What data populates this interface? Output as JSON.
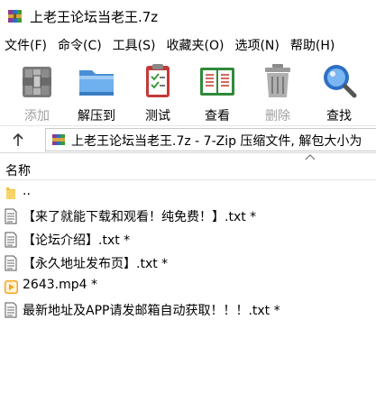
{
  "window": {
    "title": "上老王论坛当老王.7z"
  },
  "menu": [
    "文件(F)",
    "命令(C)",
    "工具(S)",
    "收藏夹(O)",
    "选项(N)",
    "帮助(H)"
  ],
  "toolbar": {
    "add": {
      "label": "添加",
      "enabled": false,
      "icon": "archive-add-icon"
    },
    "extract": {
      "label": "解压到",
      "enabled": true,
      "icon": "folder-extract-icon"
    },
    "test": {
      "label": "测试",
      "enabled": true,
      "icon": "clipboard-check-icon"
    },
    "view": {
      "label": "查看",
      "enabled": true,
      "icon": "open-book-icon"
    },
    "delete": {
      "label": "删除",
      "enabled": false,
      "icon": "trash-can-icon"
    },
    "find": {
      "label": "查找",
      "enabled": true,
      "icon": "magnifier-icon"
    }
  },
  "address": {
    "path": "上老王论坛当老王.7z - 7-Zip 压缩文件, 解包大小为"
  },
  "list": {
    "column_name": "名称",
    "items": [
      {
        "name": "..",
        "type": "folder"
      },
      {
        "name": "【来了就能下载和观看！纯免费！】.txt *",
        "type": "text"
      },
      {
        "name": "【论坛介绍】.txt *",
        "type": "text"
      },
      {
        "name": "【永久地址发布页】.txt *",
        "type": "text"
      },
      {
        "name": "2643.mp4 *",
        "type": "video"
      },
      {
        "name": "最新地址及APP请发邮箱自动获取！！！.txt *",
        "type": "text"
      }
    ]
  },
  "colors": {
    "disabled_text": "#a0a0a0",
    "folder_yellow": "#f3c13a",
    "video_orange": "#f5a623"
  }
}
